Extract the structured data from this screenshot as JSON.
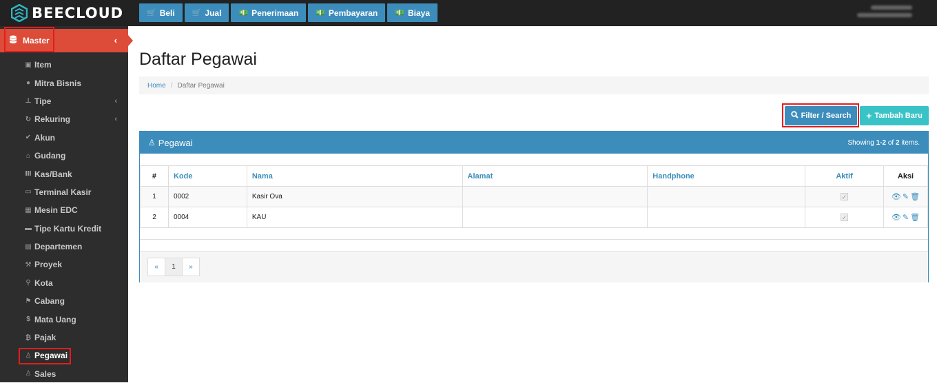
{
  "brand": {
    "name": "BEECLOUD",
    "accent": "#3c8dbc",
    "danger": "#dd4b39"
  },
  "topnav": [
    {
      "label": "Beli",
      "icon": "cart-icon"
    },
    {
      "label": "Jual",
      "icon": "cart-icon"
    },
    {
      "label": "Penerimaan",
      "icon": "money-icon"
    },
    {
      "label": "Pembayaran",
      "icon": "money-icon"
    },
    {
      "label": "Biaya",
      "icon": "money-icon"
    }
  ],
  "sidebar": {
    "master": {
      "label": "Master",
      "icon": "database-icon"
    },
    "items": [
      {
        "label": "Item",
        "icon": "cube-icon"
      },
      {
        "label": "Mitra Bisnis",
        "icon": "users-icon"
      },
      {
        "label": "Tipe",
        "icon": "sitemap-icon"
      },
      {
        "label": "Rekuring",
        "icon": "refresh-icon"
      },
      {
        "label": "Akun",
        "icon": "check-icon"
      },
      {
        "label": "Gudang",
        "icon": "home-icon"
      },
      {
        "label": "Kas/Bank",
        "icon": "bank-icon"
      },
      {
        "label": "Terminal Kasir",
        "icon": "desktop-icon"
      },
      {
        "label": "Mesin EDC",
        "icon": "calculator-icon"
      },
      {
        "label": "Tipe Kartu Kredit",
        "icon": "credit-card-icon"
      },
      {
        "label": "Departemen",
        "icon": "building-icon"
      },
      {
        "label": "Proyek",
        "icon": "gavel-icon"
      },
      {
        "label": "Kota",
        "icon": "map-marker-icon"
      },
      {
        "label": "Cabang",
        "icon": "flag-icon"
      },
      {
        "label": "Mata Uang",
        "icon": "dollar-icon"
      },
      {
        "label": "Pajak",
        "icon": "bitcoin-icon"
      },
      {
        "label": "Pegawai",
        "icon": "person-icon"
      },
      {
        "label": "Sales",
        "icon": "person-icon"
      }
    ]
  },
  "page": {
    "title": "Daftar Pegawai",
    "breadcrumb": {
      "home": "Home",
      "sep": "/",
      "current": "Daftar Pegawai"
    }
  },
  "actions": {
    "filter": "Filter / Search",
    "add": "Tambah Baru"
  },
  "panel": {
    "title": "Pegawai",
    "summary_prefix": "Showing ",
    "summary_range": "1-2",
    "summary_mid": " of ",
    "summary_total": "2",
    "summary_suffix": " items."
  },
  "table": {
    "headers": {
      "num": "#",
      "kode": "Kode",
      "nama": "Nama",
      "alamat": "Alamat",
      "hp": "Handphone",
      "aktif": "Aktif",
      "aksi": "Aksi"
    },
    "rows": [
      {
        "num": "1",
        "kode": "0002",
        "nama": "Kasir Ova",
        "alamat": "",
        "hp": "",
        "aktif": true
      },
      {
        "num": "2",
        "kode": "0004",
        "nama": "KAU",
        "alamat": "",
        "hp": "",
        "aktif": true
      }
    ]
  },
  "pagination": {
    "prev": "«",
    "page": "1",
    "next": "»"
  }
}
